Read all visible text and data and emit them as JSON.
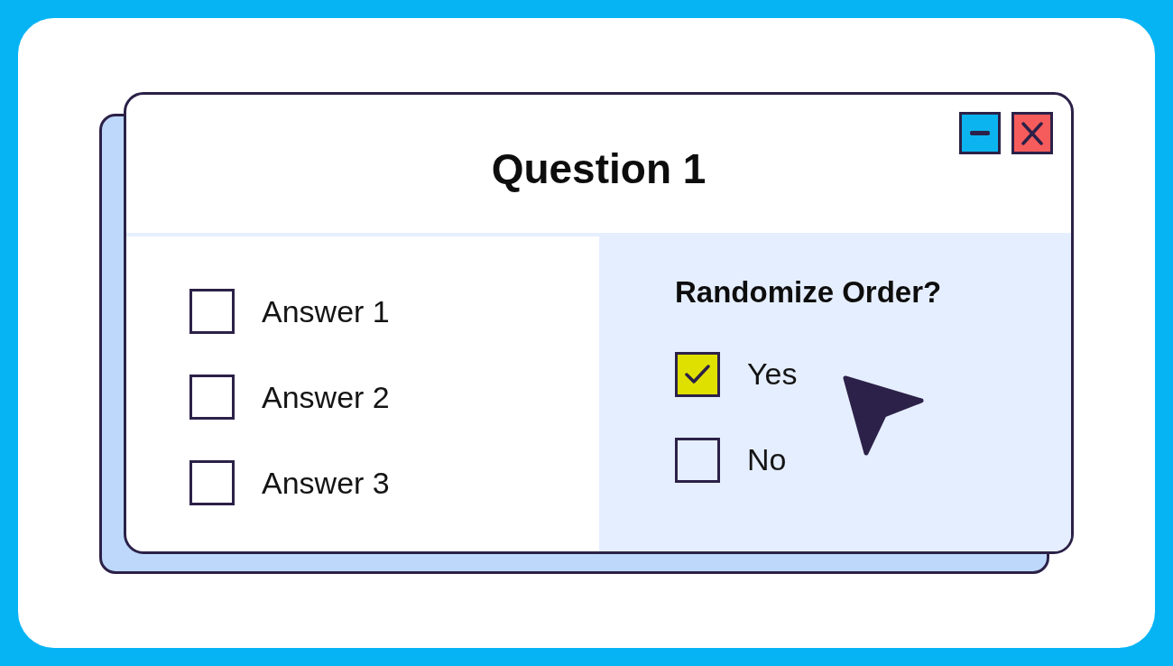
{
  "window": {
    "title": "Question 1"
  },
  "answers": [
    {
      "label": "Answer 1",
      "checked": false
    },
    {
      "label": "Answer 2",
      "checked": false
    },
    {
      "label": "Answer 3",
      "checked": false
    }
  ],
  "randomize_order": {
    "heading": "Randomize Order?",
    "options": [
      {
        "label": "Yes",
        "checked": true
      },
      {
        "label": "No",
        "checked": false
      }
    ]
  }
}
